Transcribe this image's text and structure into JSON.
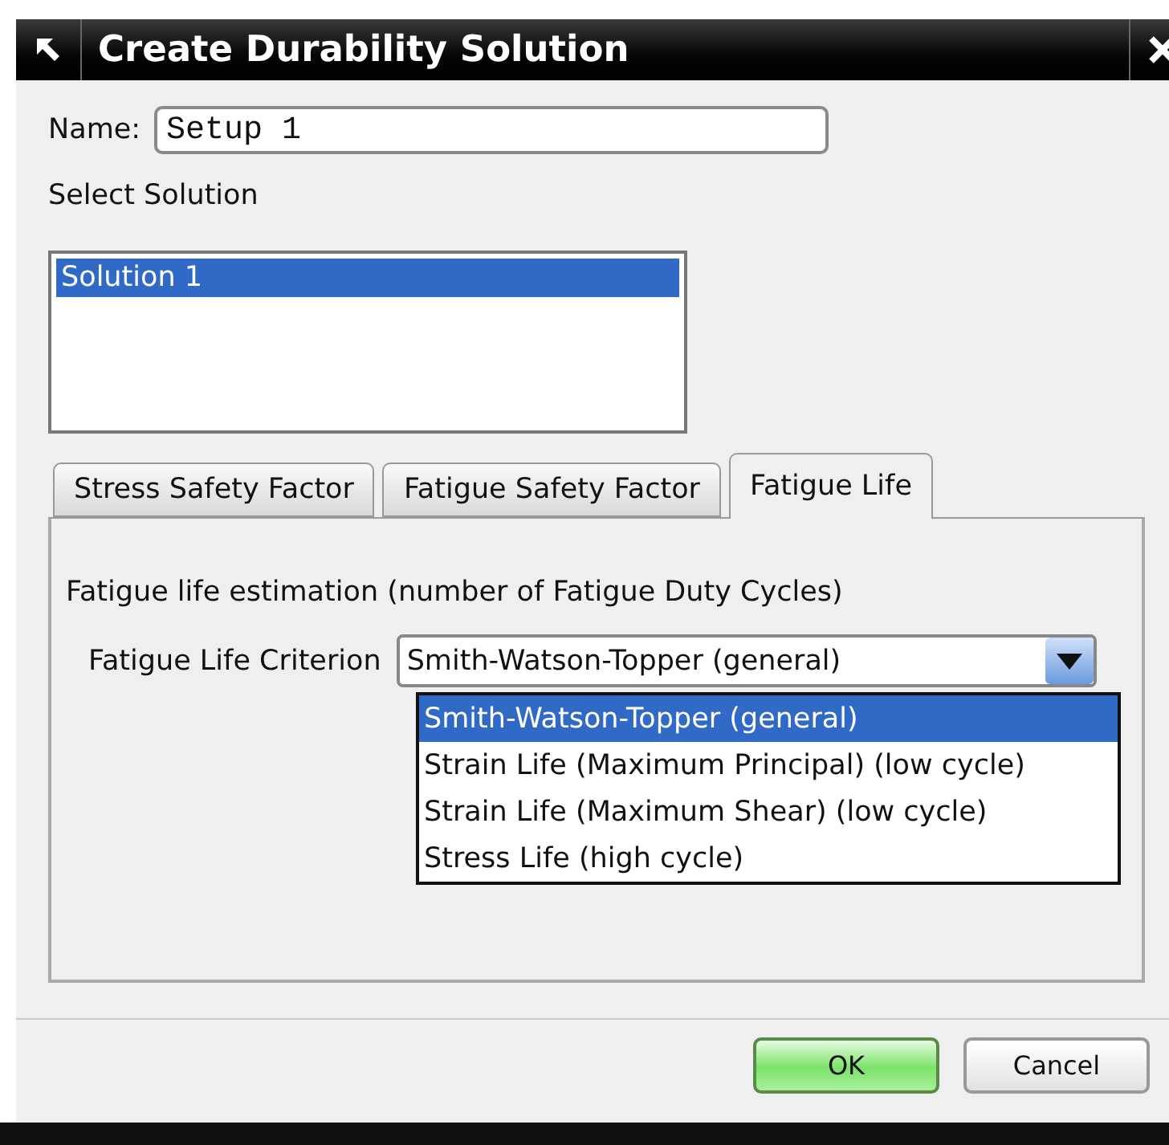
{
  "window": {
    "title": "Create Durability Solution"
  },
  "name_field": {
    "label": "Name:",
    "value": "Setup 1"
  },
  "solution_list": {
    "label": "Select Solution",
    "items": [
      {
        "label": "Solution 1",
        "selected": true
      }
    ]
  },
  "tabs": [
    {
      "label": "Stress Safety Factor",
      "selected": false
    },
    {
      "label": "Fatigue Safety Factor",
      "selected": false
    },
    {
      "label": "Fatigue Life",
      "selected": true
    }
  ],
  "fatigue_life": {
    "description": "Fatigue life estimation (number of Fatigue Duty Cycles)",
    "criterion": {
      "label": "Fatigue Life Criterion",
      "value": "Smith-Watson-Topper (general)",
      "expanded": true,
      "options": [
        {
          "label": "Smith-Watson-Topper (general)",
          "selected": true
        },
        {
          "label": "Strain Life (Maximum Principal) (low cycle)",
          "selected": false
        },
        {
          "label": "Strain Life (Maximum Shear) (low cycle)",
          "selected": false
        },
        {
          "label": "Stress Life (high cycle)",
          "selected": false
        }
      ]
    }
  },
  "buttons": [
    {
      "label": "OK",
      "kind": "default"
    },
    {
      "label": "Cancel",
      "kind": "normal"
    }
  ]
}
